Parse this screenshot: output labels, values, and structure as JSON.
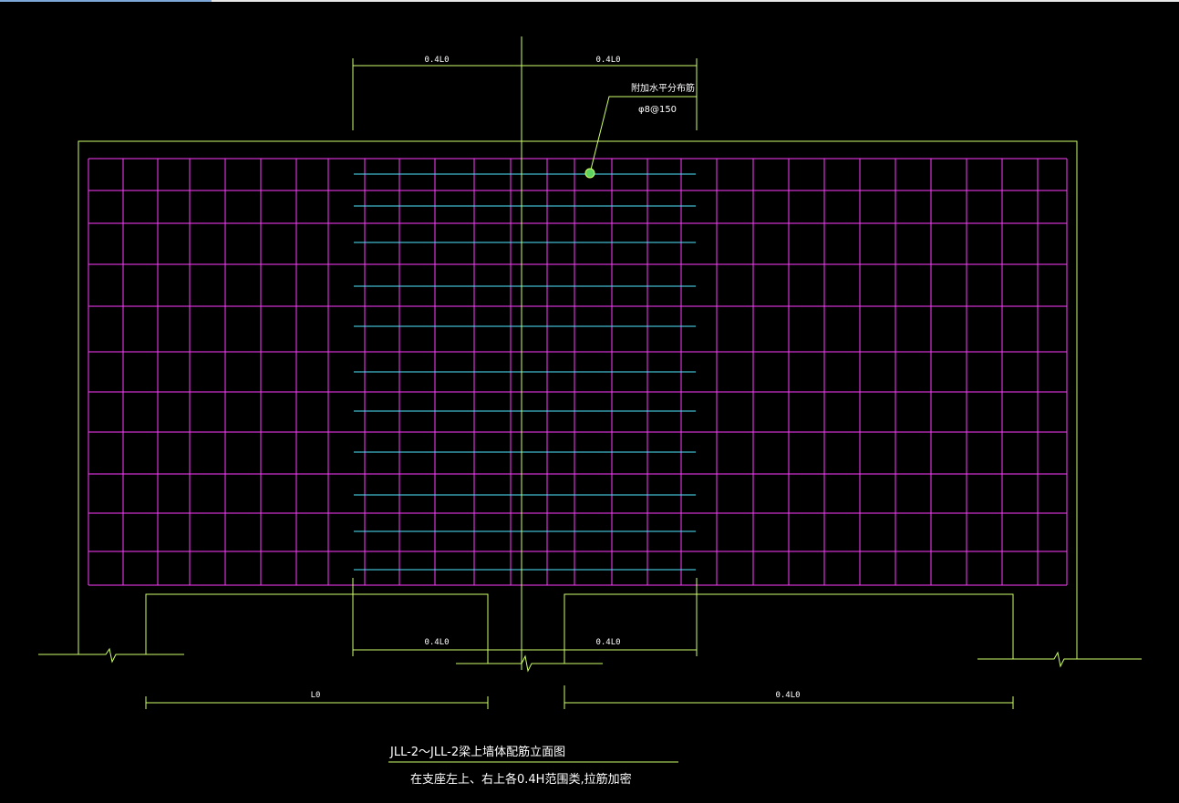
{
  "colors": {
    "background": "#000000",
    "outline": "#cfff6a",
    "mesh": "#ff3cff",
    "extra_bars": "#4fe8ff",
    "text": "#ffffff",
    "marker": "#5fd35f"
  },
  "dimensions": {
    "top_left": "0.4L0",
    "top_right": "0.4L0",
    "bottom_left": "0.4L0",
    "bottom_right": "0.4L0",
    "span_left": "L0",
    "span_right": "0.4L0"
  },
  "annotation": {
    "line1": "附加水平分布筋",
    "line2": "φ8@150"
  },
  "title": {
    "main": "JLL-2～JLL-2梁上墙体配筋立面图",
    "sub": "在支座左上、右上各0.4H范围类,拉筋加密"
  }
}
